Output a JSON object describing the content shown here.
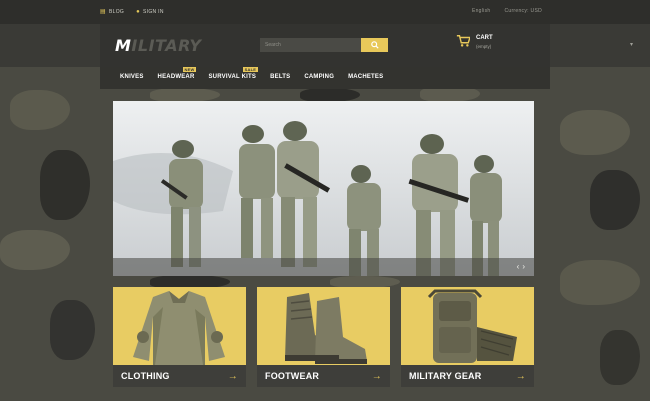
{
  "topbar": {
    "blog": "BLOG",
    "sign_in": "SIGN IN",
    "language": "English",
    "currency": "Currency: USD"
  },
  "header": {
    "logo_m": "M",
    "logo_rest": "ILITARY",
    "search_placeholder": "Search",
    "cart_label": "CART",
    "cart_sub": "(empty)"
  },
  "nav": {
    "items": [
      {
        "label": "KNIVES"
      },
      {
        "label": "HEADWEAR",
        "badge": "NEW"
      },
      {
        "label": "SURVIVAL KITS",
        "badge": "SALE"
      },
      {
        "label": "BELTS"
      },
      {
        "label": "CAMPING"
      },
      {
        "label": "MACHETES"
      }
    ]
  },
  "slider": {
    "prev": "‹",
    "next": "›"
  },
  "tiles": [
    {
      "label": "CLOTHING"
    },
    {
      "label": "FOOTWEAR"
    },
    {
      "label": "MILITARY GEAR"
    }
  ],
  "colors": {
    "accent": "#e8c85a",
    "dark": "#333330"
  },
  "icons": [
    "blog-icon",
    "user-icon",
    "search-icon",
    "cart-icon",
    "arrow-right-icon"
  ]
}
